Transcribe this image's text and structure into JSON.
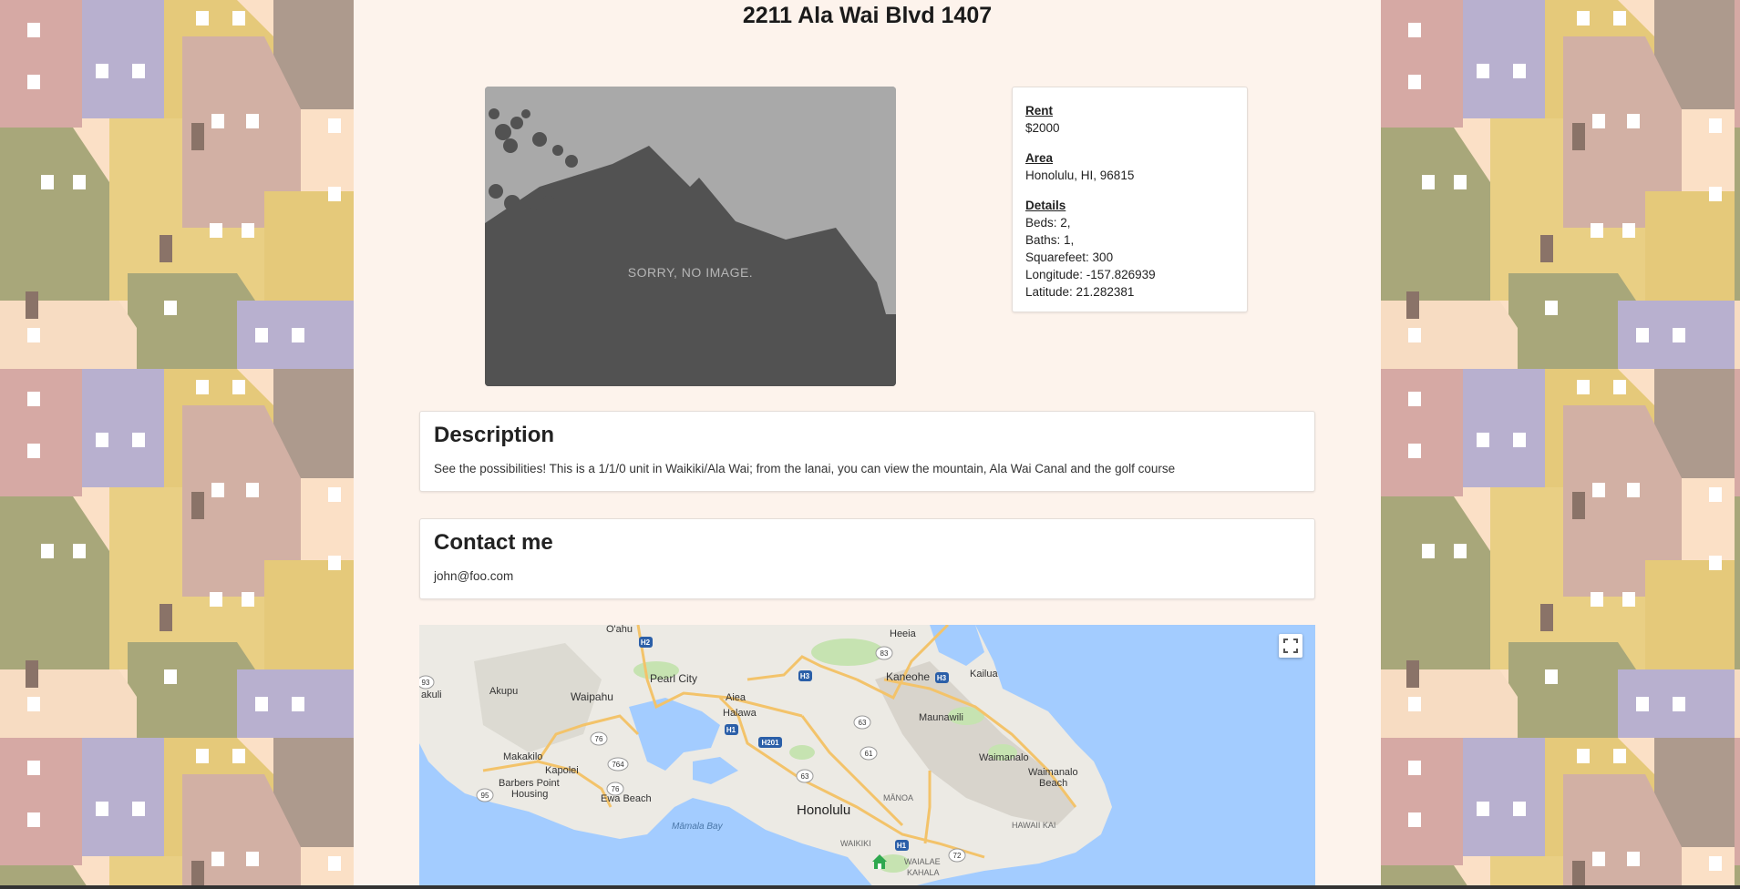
{
  "listing": {
    "address": "2211 Ala Wai Blvd  1407",
    "no_image_text": "SORRY, NO IMAGE."
  },
  "info": {
    "rent_label": "Rent",
    "rent_value": "$2000",
    "area_label": "Area",
    "area_value": "Honolulu,  HI,  96815",
    "details_label": "Details",
    "beds": "Beds:  2,",
    "baths": "Baths:  1,",
    "squarefeet": "Squarefeet:  300",
    "longitude": "Longitude:  -157.826939",
    "latitude": "Latitude:  21.282381"
  },
  "description": {
    "heading": "Description",
    "text": "See the possibilities! This is a 1/1/0 unit in Waikiki/Ala Wai; from the lanai, you can view the mountain, Ala Wai Canal and the golf course"
  },
  "contact": {
    "heading": "Contact me",
    "email": "john@foo.com"
  },
  "map": {
    "labels": {
      "oahu": "O'ahu",
      "heeia": "Heeia",
      "kaneohe": "Kaneohe",
      "kailua": "Kailua",
      "pearl_city": "Pearl City",
      "aiea": "Aiea",
      "halawa": "Halawa",
      "waipahu": "Waipahu",
      "akupu": "Akupu",
      "makakilo": "Makakilo",
      "kapolei": "Kapolei",
      "barbers_point": "Barbers Point",
      "housing": "Housing",
      "ewa_beach": "Ewa Beach",
      "mamala_bay": "Māmala Bay",
      "honolulu": "Honolulu",
      "manoa": "MĀNOA",
      "maunawili": "Maunawili",
      "waimanalo": "Waimanalo",
      "waimanalo_beach_1": "Waimanalo",
      "waimanalo_beach_2": "Beach",
      "hawaii_kai": "HAWAII KAI",
      "waikiki": "WAIKIKI",
      "waialae": "WAIALAE",
      "kahala": "KAHALA",
      "makua": "akuli"
    },
    "shields": {
      "h1a": "H1",
      "h1b": "H1",
      "h2": "H2",
      "h3a": "H3",
      "h3b": "H3",
      "h201": "H201",
      "r63a": "63",
      "r63b": "63",
      "r61": "61",
      "r76a": "76",
      "r76b": "76",
      "r764": "764",
      "r95": "95",
      "r72": "72",
      "r83": "83",
      "r93": "93"
    },
    "colors": {
      "water": "#a3ccff",
      "land": "#eceae4",
      "road": "#f3c36a",
      "marker": "#2fa84f"
    }
  }
}
